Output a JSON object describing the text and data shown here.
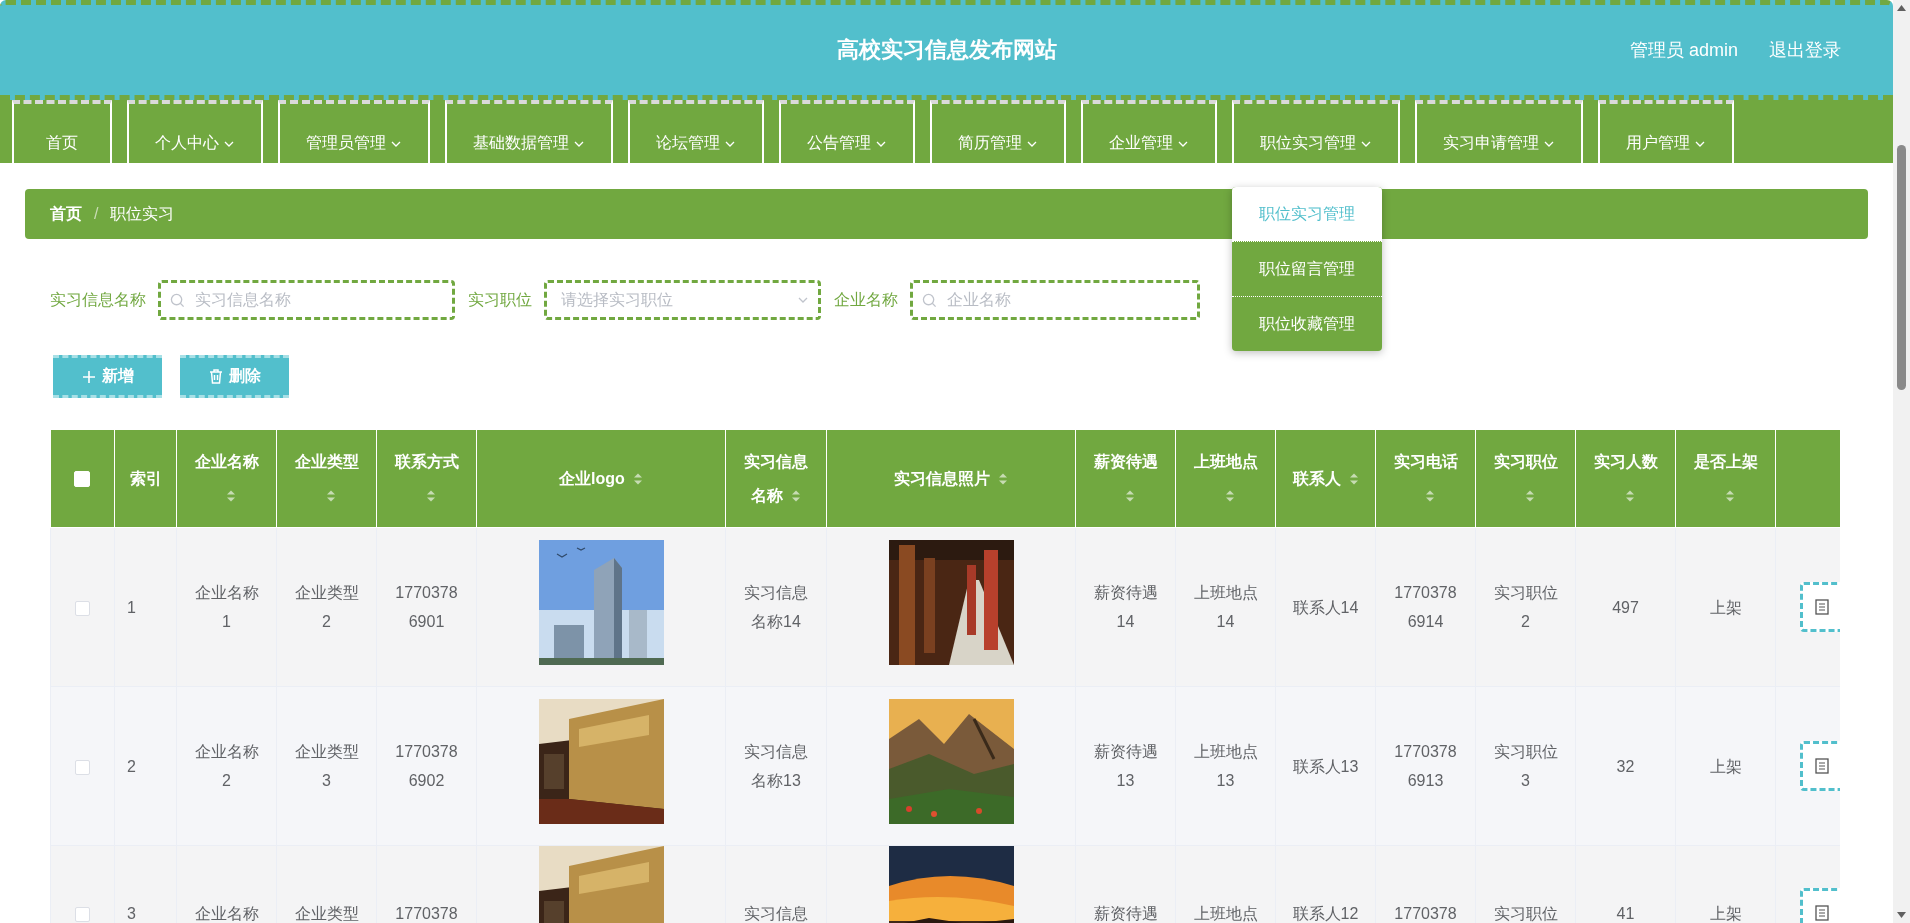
{
  "header": {
    "title": "高校实习信息发布网站",
    "user": "管理员 admin",
    "logout": "退出登录"
  },
  "nav": [
    {
      "label": "首页",
      "has_menu": false
    },
    {
      "label": "个人中心",
      "has_menu": true
    },
    {
      "label": "管理员管理",
      "has_menu": true
    },
    {
      "label": "基础数据管理",
      "has_menu": true
    },
    {
      "label": "论坛管理",
      "has_menu": true
    },
    {
      "label": "公告管理",
      "has_menu": true
    },
    {
      "label": "简历管理",
      "has_menu": true
    },
    {
      "label": "企业管理",
      "has_menu": true
    },
    {
      "label": "职位实习管理",
      "has_menu": true,
      "menu": [
        {
          "label": "职位实习管理",
          "selected": true
        },
        {
          "label": "职位留言管理",
          "selected": false
        },
        {
          "label": "职位收藏管理",
          "selected": false
        }
      ]
    },
    {
      "label": "实习申请管理",
      "has_menu": true
    },
    {
      "label": "用户管理",
      "has_menu": true
    }
  ],
  "breadcrumb": {
    "items": [
      "首页",
      "职位实习"
    ],
    "separator": "/"
  },
  "search": {
    "fields": [
      {
        "label": "实习信息名称",
        "kind": "search",
        "placeholder": "实习信息名称"
      },
      {
        "label": "实习职位",
        "kind": "select",
        "placeholder": "请选择实习职位"
      },
      {
        "label": "企业名称",
        "kind": "search",
        "placeholder": "企业名称"
      }
    ]
  },
  "buttons": [
    {
      "label": "新增",
      "kind": "add"
    },
    {
      "label": "删除",
      "kind": "delete"
    }
  ],
  "table": {
    "select_all": {
      "checked": false
    },
    "columns": [
      {
        "label": "索引",
        "sortable": false
      },
      {
        "label": "企业名称",
        "sortable": true
      },
      {
        "label": "企业类型",
        "sortable": true
      },
      {
        "label": "联系方式",
        "sortable": true
      },
      {
        "label": "企业logo",
        "sortable": true
      },
      {
        "label": "实习信息名称",
        "sortable": true
      },
      {
        "label": "实习信息照片",
        "sortable": true
      },
      {
        "label": "薪资待遇",
        "sortable": true
      },
      {
        "label": "上班地点",
        "sortable": true
      },
      {
        "label": "联系人",
        "sortable": true
      },
      {
        "label": "实习电话",
        "sortable": true
      },
      {
        "label": "实习职位",
        "sortable": true
      },
      {
        "label": "实习人数",
        "sortable": true
      },
      {
        "label": "是否上架",
        "sortable": true
      }
    ],
    "rows": [
      {
        "checked": false,
        "cells": [
          "1",
          "企业名称1",
          "企业类型2",
          "17703786901",
          {
            "kind": "picture"
          },
          "实习信息名称14",
          {
            "kind": "picture"
          },
          "薪资待遇14",
          "上班地点14",
          "联系人14",
          "17703786914",
          "实习职位2",
          "497",
          "上架"
        ]
      },
      {
        "checked": false,
        "cells": [
          "2",
          "企业名称2",
          "企业类型3",
          "17703786902",
          {
            "kind": "picture"
          },
          "实习信息名称13",
          {
            "kind": "picture"
          },
          "薪资待遇13",
          "上班地点13",
          "联系人13",
          "17703786913",
          "实习职位3",
          "32",
          "上架"
        ]
      },
      {
        "checked": false,
        "cells": [
          "3",
          "企业名称",
          "企业类型",
          "1770378",
          {
            "kind": "picture"
          },
          "实习信息",
          {
            "kind": "picture"
          },
          "薪资待遇",
          "上班地点",
          "联系人12",
          "1770378",
          "实习职位",
          "41",
          "上架"
        ]
      }
    ]
  }
}
